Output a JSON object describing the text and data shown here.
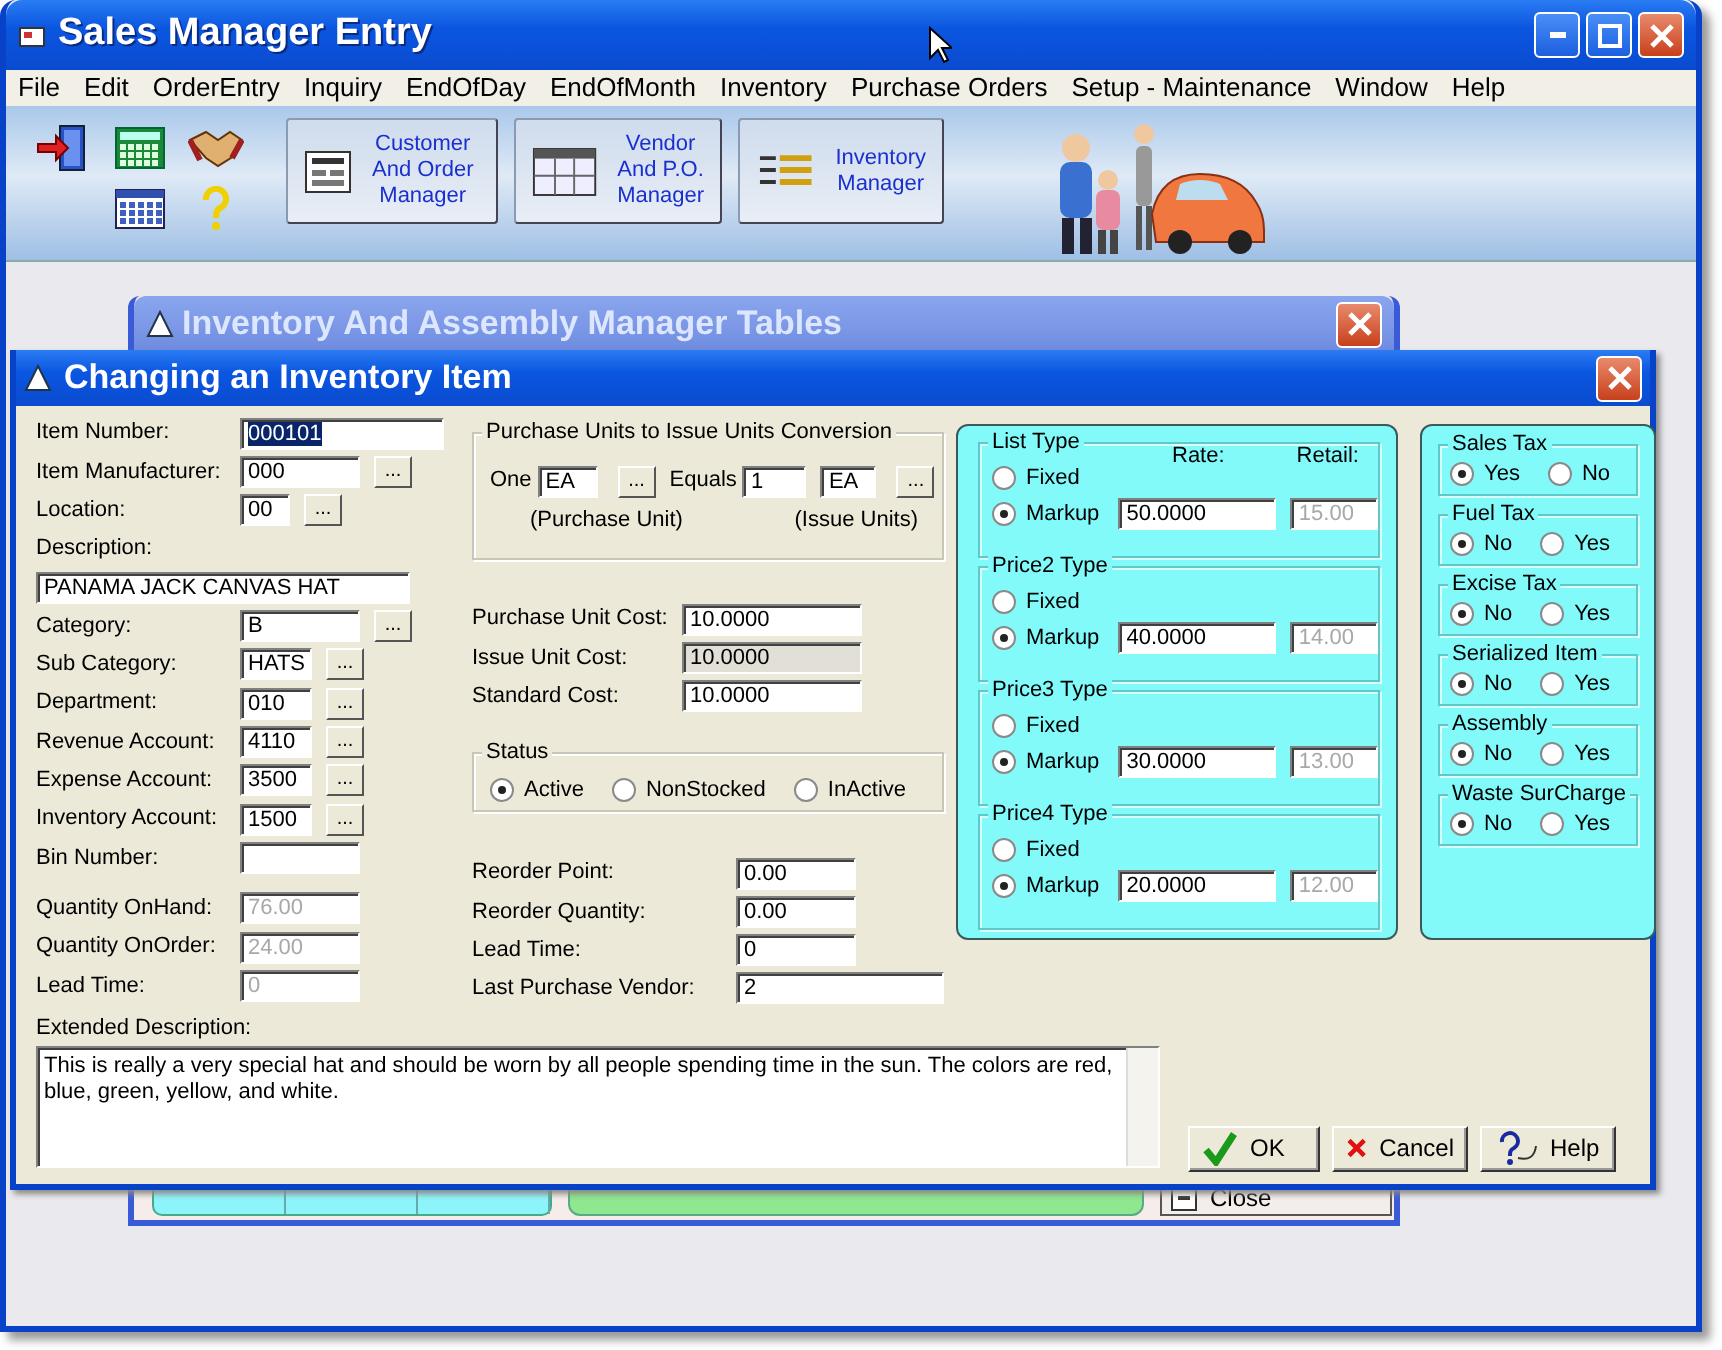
{
  "window": {
    "title": "Sales Manager Entry"
  },
  "menu": [
    "File",
    "Edit",
    "OrderEntry",
    "Inquiry",
    "EndOfDay",
    "EndOfMonth",
    "Inventory",
    "Purchase Orders",
    "Setup - Maintenance",
    "Window",
    "Help"
  ],
  "toolbar": {
    "buttons": [
      {
        "label": "Customer\nAnd Order\nManager",
        "kind": "form"
      },
      {
        "label": "Vendor\nAnd P.O.\nManager",
        "kind": "grid"
      },
      {
        "label": "Inventory\nManager",
        "kind": "list"
      }
    ]
  },
  "back_window": {
    "title": "Inventory And Assembly Manager Tables",
    "close_button": "Close"
  },
  "dialog": {
    "title": "Changing an Inventory Item",
    "fields": [
      {
        "label": "Item Number:",
        "value": "000101",
        "kind": "wide",
        "text_selected": true,
        "disabled": false
      },
      {
        "label": "Item Manufacturer:",
        "value": "000",
        "kind": "lookup",
        "lookup": "...",
        "text_selected": false,
        "disabled": false
      },
      {
        "label": "Location:",
        "value": "00",
        "kind": "lookup",
        "lookup": "...",
        "text_selected": false,
        "disabled": false
      },
      {
        "label": "Description:",
        "value": "PANAMA JACK CANVAS HAT",
        "kind": "stacked",
        "text_selected": false,
        "disabled": false
      },
      {
        "label": "Category:",
        "value": "B",
        "kind": "lookup",
        "lookup": "...",
        "text_selected": false,
        "disabled": false
      },
      {
        "label": "Sub Category:",
        "value": "HATS",
        "kind": "lookup",
        "lookup": "...",
        "text_selected": false,
        "disabled": false
      },
      {
        "label": "Department:",
        "value": "010",
        "kind": "lookup",
        "lookup": "...",
        "text_selected": false,
        "disabled": false
      },
      {
        "label": "Revenue Account:",
        "value": "4110",
        "kind": "lookup",
        "lookup": "...",
        "text_selected": false,
        "disabled": false
      },
      {
        "label": "Expense Account:",
        "value": "3500",
        "kind": "lookup",
        "lookup": "...",
        "text_selected": false,
        "disabled": false
      },
      {
        "label": "Inventory Account:",
        "value": "1500",
        "kind": "lookup",
        "lookup": "...",
        "text_selected": false,
        "disabled": false
      },
      {
        "label": "Bin Number:",
        "kind": "text"
      },
      {
        "label": "Quantity OnHand:",
        "value": "76.00",
        "kind": "text",
        "text_selected": false,
        "disabled": true
      },
      {
        "label": "Quantity OnOrder:",
        "value": "24.00",
        "kind": "text",
        "text_selected": false,
        "disabled": true
      },
      {
        "label": "Lead Time:",
        "value": "0",
        "kind": "text",
        "text_selected": false,
        "disabled": true
      }
    ],
    "conversion": {
      "title": "Purchase Units to Issue Units Conversion",
      "one_label": "One",
      "purchase_unit": "EA",
      "lookup": "...",
      "equals_label": "Equals",
      "factor": "1",
      "issue_unit": "EA",
      "issue_lookup": "...",
      "purchase_caption": "(Purchase Unit)",
      "issue_caption": "(Issue Units)"
    },
    "costs": [
      {
        "label": "Purchase Unit Cost:",
        "value": "10.0000",
        "disabled": false
      },
      {
        "label": "Issue Unit Cost:",
        "value": "10.0000",
        "disabled": true
      },
      {
        "label": "Standard Cost:",
        "value": "10.0000",
        "disabled": false
      }
    ],
    "status": {
      "title": "Status",
      "options": [
        {
          "label": "Active",
          "selected": true
        },
        {
          "label": "NonStocked",
          "selected": false
        },
        {
          "label": "InActive",
          "selected": false
        }
      ]
    },
    "reorder": [
      {
        "label": "Reorder Point:",
        "value": "0.00",
        "kind": "short"
      },
      {
        "label": "Reorder Quantity:",
        "value": "0.00",
        "kind": "short"
      },
      {
        "label": "Lead Time:",
        "value": "0",
        "kind": "short"
      },
      {
        "label": "Last Purchase Vendor:",
        "value": "2",
        "kind": "long"
      }
    ],
    "prices": {
      "rate_header": "Rate:",
      "retail_header": "Retail:",
      "groups": [
        {
          "title": "List Type",
          "options": [
            {
              "label": "Fixed",
              "selected": false
            },
            {
              "label": "Markup",
              "selected": true
            }
          ],
          "rate": "50.0000",
          "retail": "15.00",
          "retail_disabled": true
        },
        {
          "title": "Price2 Type",
          "options": [
            {
              "label": "Fixed",
              "selected": false
            },
            {
              "label": "Markup",
              "selected": true
            }
          ],
          "rate": "40.0000",
          "retail": "14.00",
          "retail_disabled": true
        },
        {
          "title": "Price3 Type",
          "options": [
            {
              "label": "Fixed",
              "selected": false
            },
            {
              "label": "Markup",
              "selected": true
            }
          ],
          "rate": "30.0000",
          "retail": "13.00",
          "retail_disabled": true
        },
        {
          "title": "Price4 Type",
          "options": [
            {
              "label": "Fixed",
              "selected": false
            },
            {
              "label": "Markup",
              "selected": true
            }
          ],
          "rate": "20.0000",
          "retail": "12.00",
          "retail_disabled": true
        }
      ]
    },
    "taxes": [
      {
        "title": "Sales Tax",
        "options": [
          {
            "label": "Yes",
            "selected": true
          },
          {
            "label": "No",
            "selected": false
          }
        ]
      },
      {
        "title": "Fuel Tax",
        "options": [
          {
            "label": "No",
            "selected": true
          },
          {
            "label": "Yes",
            "selected": false
          }
        ]
      },
      {
        "title": "Excise Tax",
        "options": [
          {
            "label": "No",
            "selected": true
          },
          {
            "label": "Yes",
            "selected": false
          }
        ]
      },
      {
        "title": "Serialized Item",
        "options": [
          {
            "label": "No",
            "selected": true
          },
          {
            "label": "Yes",
            "selected": false
          }
        ]
      },
      {
        "title": "Assembly",
        "options": [
          {
            "label": "No",
            "selected": true
          },
          {
            "label": "Yes",
            "selected": false
          }
        ]
      },
      {
        "title": "Waste SurCharge",
        "options": [
          {
            "label": "No",
            "selected": true
          },
          {
            "label": "Yes",
            "selected": false
          }
        ]
      }
    ],
    "extended_description": {
      "label": "Extended Description:",
      "value": "This is really a very special hat and should be worn by all people spending time in the sun.  The colors are red, blue, green, yellow, and white."
    },
    "buttons": [
      {
        "label": "OK",
        "kind": "ok"
      },
      {
        "label": "Cancel",
        "kind": "cancel"
      },
      {
        "label": "Help",
        "kind": "help"
      }
    ]
  }
}
